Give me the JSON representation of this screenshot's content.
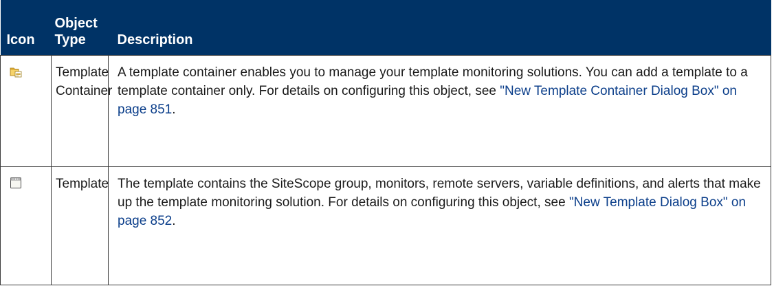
{
  "table": {
    "headers": {
      "icon": "Icon",
      "object_type_line1": "Object",
      "object_type_line2": "Type",
      "description": "Description"
    },
    "rows": [
      {
        "icon": "template-container-folder-icon",
        "object_type_line1": "Template",
        "object_type_line2": "Container",
        "desc_text": "A template container enables you to manage your template monitoring solutions. You can add a template to a template container only. For details on configuring this object, see ",
        "desc_link": "\"New Template Container Dialog Box\" on page 851",
        "desc_tail": "."
      },
      {
        "icon": "template-document-icon",
        "object_type_line1": "Template",
        "object_type_line2": "",
        "desc_text": "The template contains the SiteScope group, monitors, remote servers, variable definitions, and alerts that make up the template monitoring solution. For details on configuring this object, see ",
        "desc_link": "\"New Template Dialog Box\" on page 852",
        "desc_tail": "."
      }
    ]
  },
  "colors": {
    "header_background": "#003366",
    "header_text": "#ffffff",
    "link": "#0b3e8a",
    "border": "#3a3a3a"
  }
}
